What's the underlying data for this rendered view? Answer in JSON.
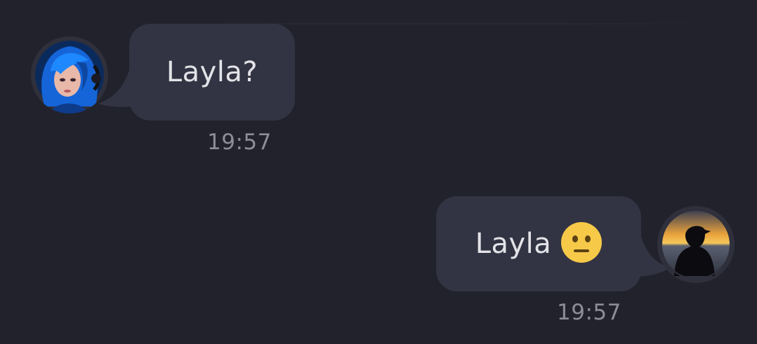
{
  "messages": [
    {
      "direction": "incoming",
      "avatar_icon": "blue-haired-girl-avatar",
      "text": "Layla?",
      "time": "19:57"
    },
    {
      "direction": "outgoing",
      "avatar_icon": "silhouette-sunset-avatar",
      "text": "Layla",
      "emoji": "neutral-face-emoji",
      "time": "19:57"
    }
  ],
  "colors": {
    "background": "#21222c",
    "bubble": "#333443",
    "text": "#e3e3e8",
    "timestamp": "#8c8d96",
    "emoji": "#f7c948"
  }
}
